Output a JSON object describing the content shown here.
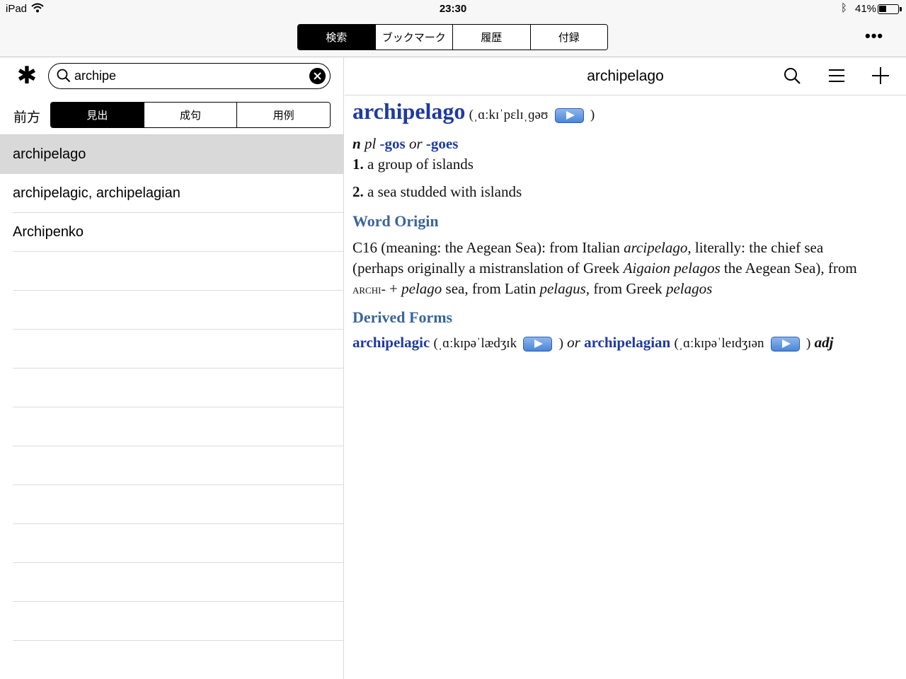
{
  "status_bar": {
    "device": "iPad",
    "time": "23:30",
    "battery": "41%",
    "battery_level": 0.41,
    "icons": [
      "wifi-icon",
      "bluetooth-icon",
      "battery-icon"
    ]
  },
  "top_tabs": {
    "items": [
      "検索",
      "ブックマーク",
      "履歴",
      "付録"
    ],
    "active_index": 0,
    "more_label": "•••"
  },
  "left_pane": {
    "search": {
      "value": "archipe",
      "placeholder": ""
    },
    "mode_label": "前方",
    "modes": [
      "見出",
      "成句",
      "用例"
    ],
    "active_mode_index": 0,
    "results": [
      "archipelago",
      "archipelagic, archipelagian",
      "Archipenko"
    ],
    "selected_index": 0
  },
  "right_pane": {
    "title": "archipelago",
    "entry": {
      "headword": "archipelago",
      "pron_open": "(",
      "pronunciation": "ˌɑːkɪˈpɛlɪˌɡəʊ",
      "pron_close": ")",
      "pos_n": "n",
      "pos_pl": "pl",
      "pl1": "-gos",
      "or": "or",
      "pl2": "-goes",
      "sense1_num": "1.",
      "sense1_text": "a group of islands",
      "sense2_num": "2.",
      "sense2_text": "a sea studded with islands",
      "origin_heading": "Word Origin",
      "origin_1": "C16 (meaning: the Aegean Sea): from Italian ",
      "origin_it1": "arcipelago,",
      "origin_2": " literally: the chief sea (perhaps originally a mistranslation of Greek ",
      "origin_it2": "Aigaion pelagos",
      "origin_3": " the Aegean Sea), from ",
      "origin_sc": "archi-",
      "origin_4": " + ",
      "origin_it3": "pelago",
      "origin_5": " sea, from Latin ",
      "origin_it4": "pelagus,",
      "origin_6": " from Greek ",
      "origin_it5": "pelagos",
      "derived_heading": "Derived Forms",
      "derived1": "archipelagic",
      "derived1_pron": "ˌɑːkɪpəˈlædʒɪk",
      "derived_or": "or",
      "derived2": "archipelagian",
      "derived2_pron": "ˌɑːkɪpəˈleɪdʒɪən",
      "derived_pos": "adj"
    }
  }
}
